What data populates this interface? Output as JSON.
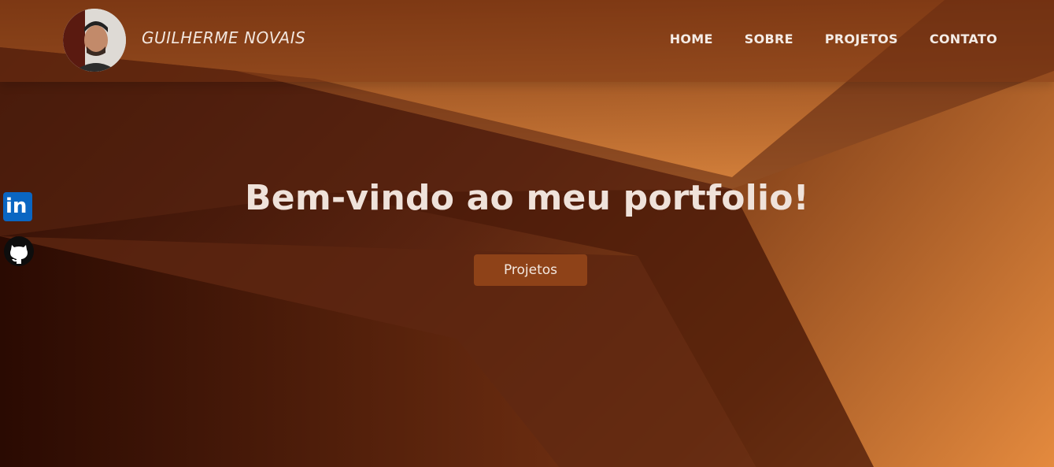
{
  "header": {
    "brand": "GUILHERME NOVAIS",
    "nav": [
      "HOME",
      "SOBRE",
      "PROJETOS",
      "CONTATO"
    ]
  },
  "social": {
    "linkedin_icon": "linkedin-icon",
    "linkedin_text": "in",
    "github_icon": "github-icon"
  },
  "hero": {
    "title_prefix": "Bem-vindo ao meu ",
    "title_bold": "portfolio",
    "title_suffix": "!",
    "button_label": "Projetos"
  },
  "colors": {
    "accent": "#8e4218",
    "linkedin": "#0a66c2",
    "text": "#efe2da"
  }
}
